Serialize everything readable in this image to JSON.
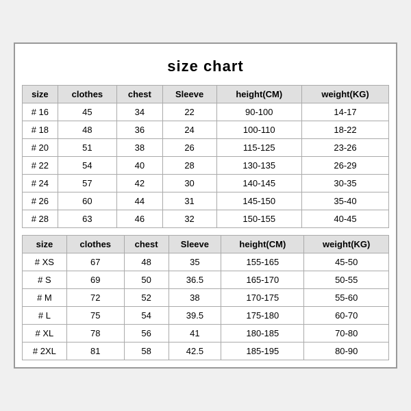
{
  "title": "size chart",
  "columns": [
    "size",
    "clothes",
    "chest",
    "Sleeve",
    "height(CM)",
    "weight(KG)"
  ],
  "table1": {
    "header": [
      "size",
      "clothes",
      "chest",
      "Sleeve",
      "height(CM)",
      "weight(KG)"
    ],
    "rows": [
      [
        "# 16",
        "45",
        "34",
        "22",
        "90-100",
        "14-17"
      ],
      [
        "# 18",
        "48",
        "36",
        "24",
        "100-110",
        "18-22"
      ],
      [
        "# 20",
        "51",
        "38",
        "26",
        "115-125",
        "23-26"
      ],
      [
        "# 22",
        "54",
        "40",
        "28",
        "130-135",
        "26-29"
      ],
      [
        "# 24",
        "57",
        "42",
        "30",
        "140-145",
        "30-35"
      ],
      [
        "# 26",
        "60",
        "44",
        "31",
        "145-150",
        "35-40"
      ],
      [
        "# 28",
        "63",
        "46",
        "32",
        "150-155",
        "40-45"
      ]
    ]
  },
  "table2": {
    "header": [
      "size",
      "clothes",
      "chest",
      "Sleeve",
      "height(CM)",
      "weight(KG)"
    ],
    "rows": [
      [
        "# XS",
        "67",
        "48",
        "35",
        "155-165",
        "45-50"
      ],
      [
        "# S",
        "69",
        "50",
        "36.5",
        "165-170",
        "50-55"
      ],
      [
        "# M",
        "72",
        "52",
        "38",
        "170-175",
        "55-60"
      ],
      [
        "# L",
        "75",
        "54",
        "39.5",
        "175-180",
        "60-70"
      ],
      [
        "# XL",
        "78",
        "56",
        "41",
        "180-185",
        "70-80"
      ],
      [
        "# 2XL",
        "81",
        "58",
        "42.5",
        "185-195",
        "80-90"
      ]
    ]
  }
}
